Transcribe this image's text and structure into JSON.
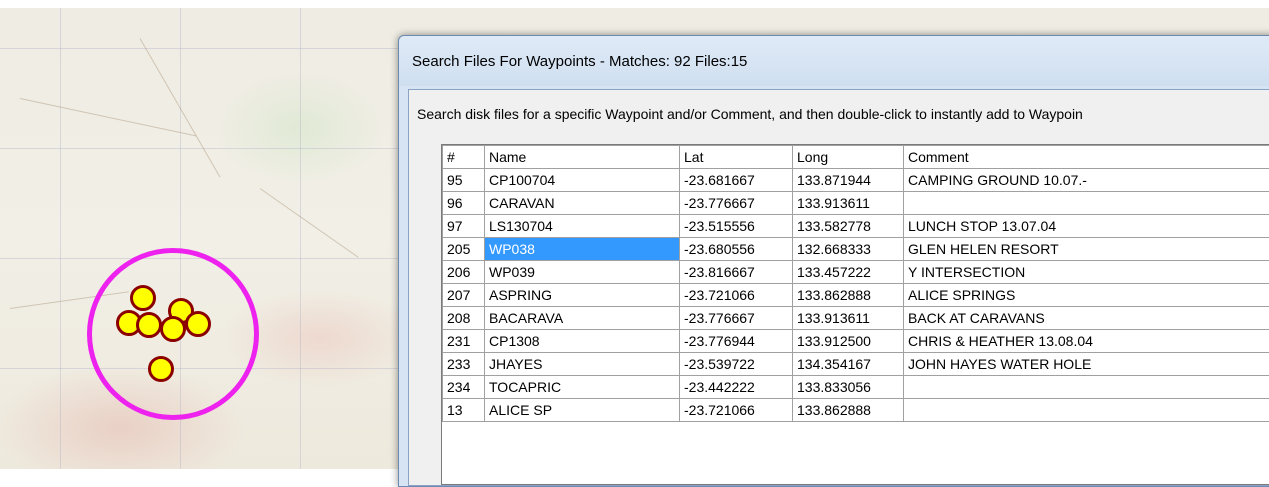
{
  "dialog": {
    "title": "Search Files For Waypoints - Matches: 92 Files:15",
    "instruction": "Search disk files for a specific Waypoint and/or Comment, and then double-click to instantly add to Waypoin",
    "columns": [
      "#",
      "Name",
      "Lat",
      "Long",
      "Comment"
    ],
    "rows": [
      {
        "num": "95",
        "name": "CP100704",
        "lat": "-23.681667",
        "long": "133.871944",
        "comment": "CAMPING GROUND 10.07.-"
      },
      {
        "num": "96",
        "name": "CARAVAN",
        "lat": "-23.776667",
        "long": "133.913611",
        "comment": ""
      },
      {
        "num": "97",
        "name": "LS130704",
        "lat": "-23.515556",
        "long": "133.582778",
        "comment": "LUNCH STOP 13.07.04"
      },
      {
        "num": "205",
        "name": "WP038",
        "lat": "-23.680556",
        "long": "132.668333",
        "comment": "GLEN HELEN RESORT",
        "selected": true
      },
      {
        "num": "206",
        "name": "WP039",
        "lat": "-23.816667",
        "long": "133.457222",
        "comment": "Y INTERSECTION"
      },
      {
        "num": "207",
        "name": "ASPRING",
        "lat": "-23.721066",
        "long": "133.862888",
        "comment": "ALICE SPRINGS"
      },
      {
        "num": "208",
        "name": "BACARAVA",
        "lat": "-23.776667",
        "long": "133.913611",
        "comment": "BACK AT CARAVANS"
      },
      {
        "num": "231",
        "name": "CP1308",
        "lat": "-23.776944",
        "long": "133.912500",
        "comment": "CHRIS & HEATHER 13.08.04"
      },
      {
        "num": "233",
        "name": "JHAYES",
        "lat": "-23.539722",
        "long": "134.354167",
        "comment": "JOHN HAYES WATER HOLE"
      },
      {
        "num": "234",
        "name": "TOCAPRIC",
        "lat": "-23.442222",
        "long": "133.833056",
        "comment": ""
      },
      {
        "num": "13",
        "name": "ALICE SP",
        "lat": "-23.721066",
        "long": "133.862888",
        "comment": ""
      }
    ]
  },
  "colors": {
    "selection": "#3399ff",
    "ring": "#ee22ee",
    "waypoint_fill": "#ffff00",
    "waypoint_border": "#8b0000"
  }
}
